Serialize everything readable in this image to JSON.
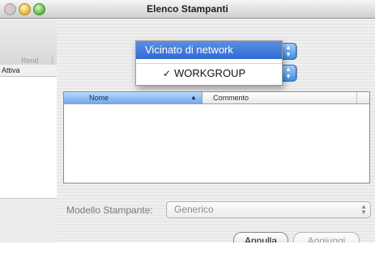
{
  "window": {
    "title": "Elenco Stampanti"
  },
  "background": {
    "toolbar_label": "Rend",
    "column_header": "Attiva"
  },
  "sheet": {
    "menu": {
      "highlighted_item": "Vicinato di network",
      "checked_item": "WORKGROUP",
      "check_glyph": "✓"
    },
    "table": {
      "columns": [
        {
          "label": "Nome",
          "sorted": true
        },
        {
          "label": "Commento",
          "sorted": false
        }
      ],
      "sort_glyph": "▲",
      "rows": []
    },
    "model": {
      "label": "Modello Stampante:",
      "value": "Generico"
    },
    "buttons": {
      "cancel": "Annulla",
      "add": "Aggiungi"
    }
  },
  "icons": {
    "popup_arrows": "up-down-arrows-icon",
    "sort": "sort-ascending-icon",
    "check": "checkmark-icon"
  },
  "colors": {
    "accent": "#2f6ad6",
    "header_selected": "#6fa8ec"
  }
}
